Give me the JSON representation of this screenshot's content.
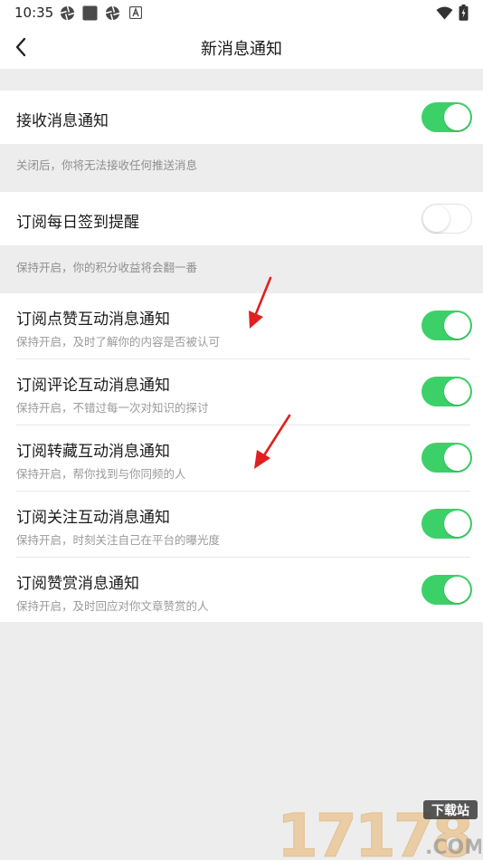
{
  "status_bar": {
    "time": "10:35",
    "left_icons": [
      "aperture-icon",
      "square-app-icon",
      "aperture-icon",
      "a-letter-notification-icon"
    ],
    "right_icons": [
      "wifi-icon",
      "battery-charging-icon"
    ]
  },
  "header": {
    "title": "新消息通知",
    "back_icon": "chevron-left-icon"
  },
  "settings": {
    "receive": {
      "label": "接收消息通知",
      "enabled": true,
      "hint": "关闭后，你将无法接收任何推送消息"
    },
    "daily_checkin": {
      "label": "订阅每日签到提醒",
      "enabled": false,
      "hint": "保持开启，你的积分收益将会翻一番"
    },
    "interactions": [
      {
        "label": "订阅点赞互动消息通知",
        "description": "保持开启，及时了解你的内容是否被认可",
        "enabled": true
      },
      {
        "label": "订阅评论互动消息通知",
        "description": "保持开启，不错过每一次对知识的探讨",
        "enabled": true
      },
      {
        "label": "订阅转藏互动消息通知",
        "description": "保持开启，帮你找到与你同频的人",
        "enabled": true
      },
      {
        "label": "订阅关注互动消息通知",
        "description": "保持开启，时刻关注自己在平台的曝光度",
        "enabled": true
      },
      {
        "label": "订阅赞赏消息通知",
        "description": "保持开启，及时回应对你文章赞赏的人",
        "enabled": true
      }
    ]
  },
  "colors": {
    "toggle_on": "#3cd168",
    "toggle_off_border": "#e2e2e2",
    "background": "#ededed",
    "annotation_arrow": "#e02020"
  },
  "watermark": {
    "number": "17178",
    "badge": "下载站",
    "suffix": ".COM"
  }
}
